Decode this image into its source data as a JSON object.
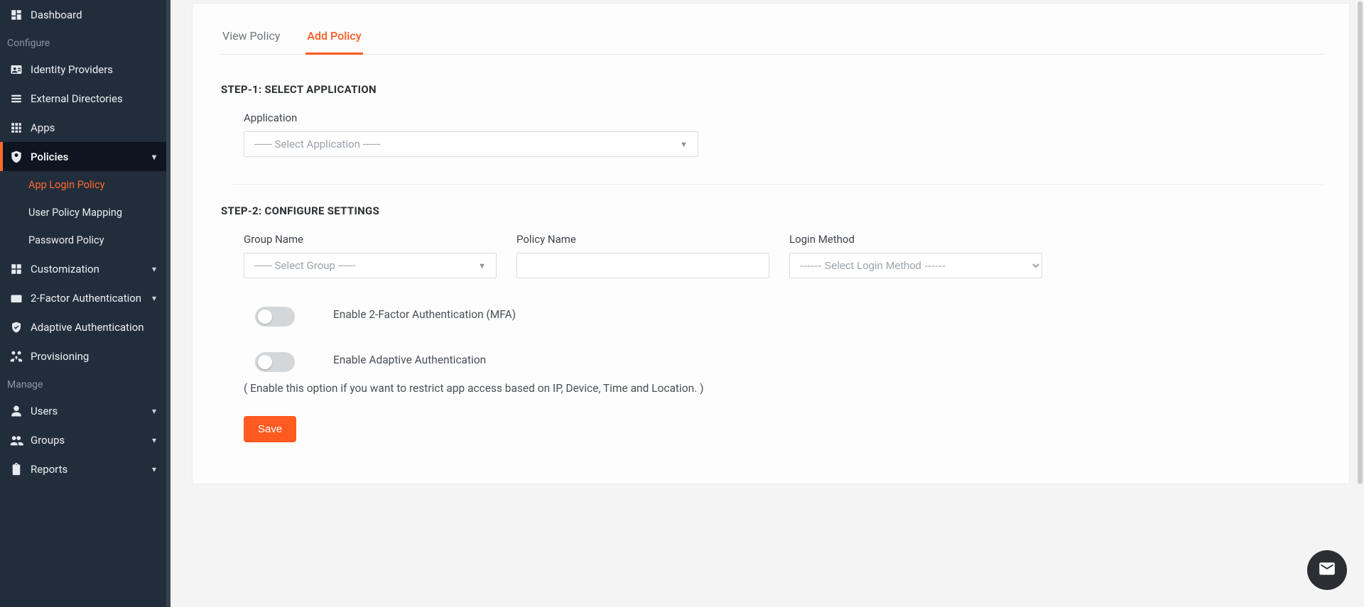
{
  "sidebar": {
    "sections": {
      "configure": "Configure",
      "manage": "Manage"
    },
    "items": {
      "dashboard": "Dashboard",
      "identity_providers": "Identity Providers",
      "external_directories": "External Directories",
      "apps": "Apps",
      "policies": "Policies",
      "customization": "Customization",
      "two_factor": "2-Factor Authentication",
      "adaptive_auth": "Adaptive Authentication",
      "provisioning": "Provisioning",
      "users": "Users",
      "groups": "Groups",
      "reports": "Reports"
    },
    "sub": {
      "app_login_policy": "App Login Policy",
      "user_policy_mapping": "User Policy Mapping",
      "password_policy": "Password Policy"
    }
  },
  "tabs": {
    "view_policy": "View Policy",
    "add_policy": "Add Policy"
  },
  "step1": {
    "heading": "STEP-1: SELECT APPLICATION",
    "application_label": "Application",
    "application_placeholder": "------ Select Application ------"
  },
  "step2": {
    "heading": "STEP-2: CONFIGURE SETTINGS",
    "group_label": "Group Name",
    "group_placeholder": "------ Select Group ------",
    "policy_label": "Policy Name",
    "policy_value": "",
    "login_method_label": "Login Method",
    "login_method_placeholder": "------ Select Login Method ------",
    "mfa_label": "Enable 2-Factor Authentication (MFA)",
    "adaptive_label": "Enable Adaptive Authentication",
    "adaptive_help": "( Enable this option if you want to restrict app access based on IP, Device, Time and Location. )"
  },
  "buttons": {
    "save": "Save"
  }
}
